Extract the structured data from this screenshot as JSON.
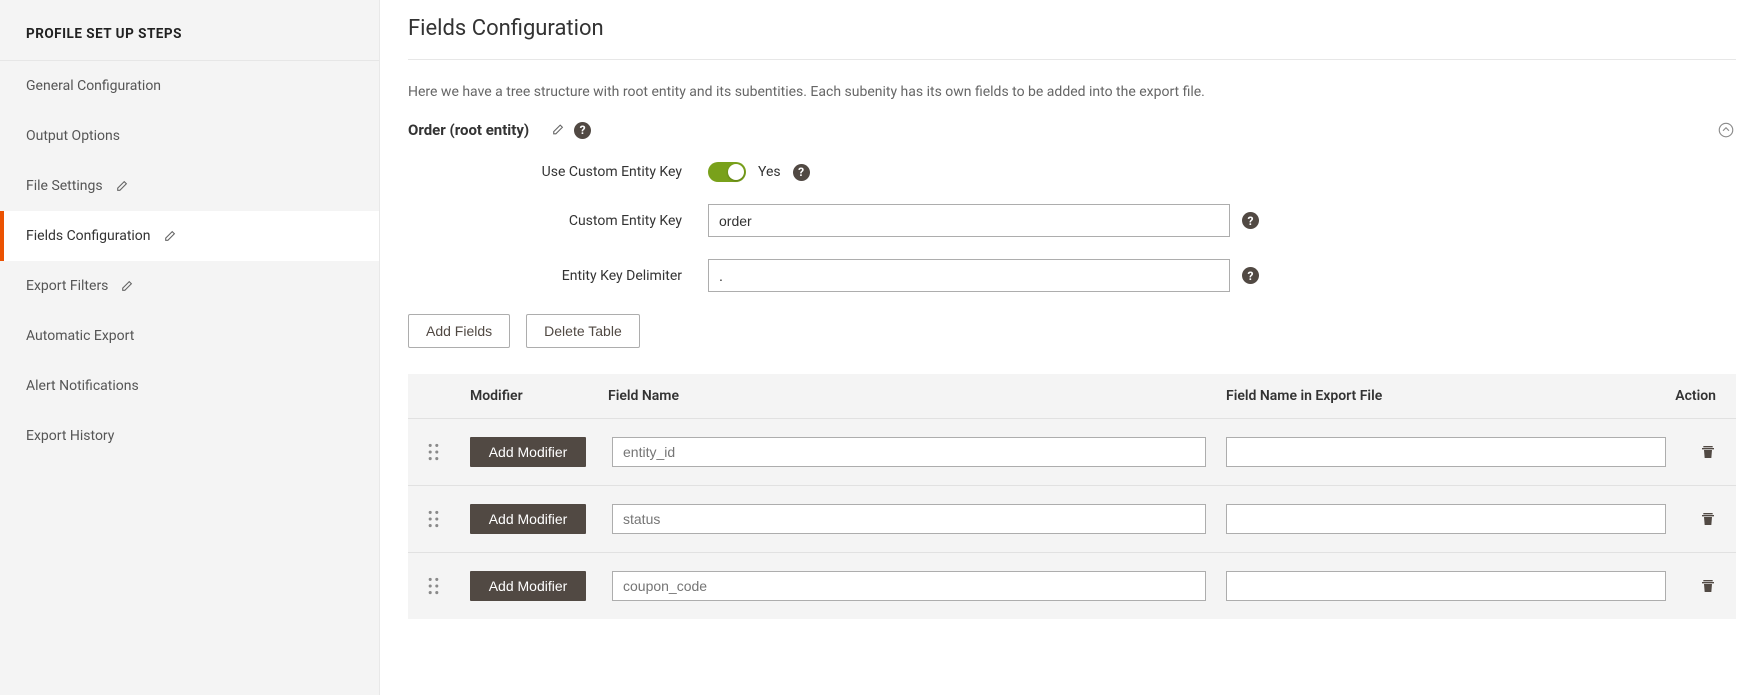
{
  "sidebar": {
    "header": "PROFILE SET UP STEPS",
    "items": [
      {
        "label": "General Configuration",
        "editable": false,
        "active": false
      },
      {
        "label": "Output Options",
        "editable": false,
        "active": false
      },
      {
        "label": "File Settings",
        "editable": true,
        "active": false
      },
      {
        "label": "Fields Configuration",
        "editable": true,
        "active": true
      },
      {
        "label": "Export Filters",
        "editable": true,
        "active": false
      },
      {
        "label": "Automatic Export",
        "editable": false,
        "active": false
      },
      {
        "label": "Alert Notifications",
        "editable": false,
        "active": false
      },
      {
        "label": "Export History",
        "editable": false,
        "active": false
      }
    ]
  },
  "main": {
    "title": "Fields Configuration",
    "description": "Here we have a tree structure with root entity and its subentities. Each subenity has its own fields to be added into the export file.",
    "entity": {
      "title": "Order (root entity)"
    },
    "form": {
      "use_custom_key_label": "Use Custom Entity Key",
      "use_custom_key_value": "Yes",
      "custom_key_label": "Custom Entity Key",
      "custom_key_value": "order",
      "delimiter_label": "Entity Key Delimiter",
      "delimiter_value": "."
    },
    "buttons": {
      "add_fields": "Add Fields",
      "delete_table": "Delete Table"
    },
    "table": {
      "headers": {
        "modifier": "Modifier",
        "field_name": "Field Name",
        "export_name": "Field Name in Export File",
        "action": "Action"
      },
      "add_modifier_label": "Add Modifier",
      "rows": [
        {
          "field_placeholder": "entity_id",
          "export_value": ""
        },
        {
          "field_placeholder": "status",
          "export_value": ""
        },
        {
          "field_placeholder": "coupon_code",
          "export_value": ""
        }
      ]
    }
  }
}
